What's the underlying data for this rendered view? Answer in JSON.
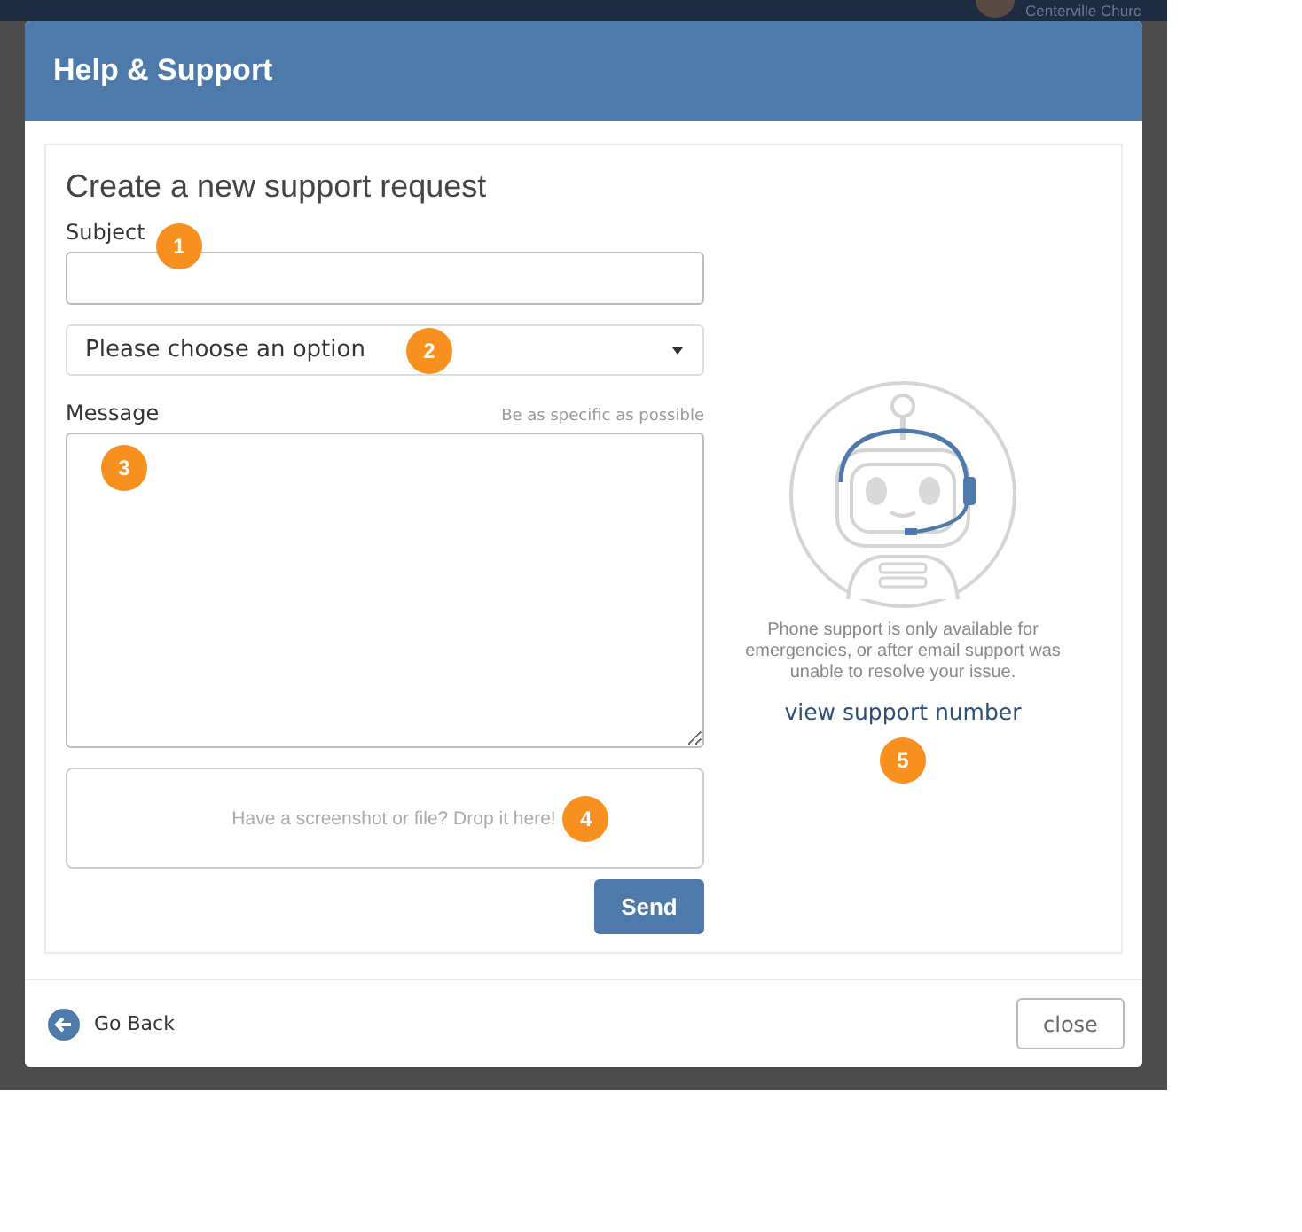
{
  "background_app": {
    "header_text": "Centerville Churc"
  },
  "dialog": {
    "title": "Help & Support"
  },
  "form": {
    "heading": "Create a new support request",
    "subject": {
      "label": "Subject",
      "badge": "1"
    },
    "category": {
      "value": "Please choose an option",
      "badge": "2"
    },
    "message": {
      "label": "Message",
      "hint": "Be as specific as possible",
      "badge": "3"
    },
    "dropzone": {
      "text": "Have a screenshot or file? Drop it here!",
      "badge": "4"
    },
    "send_button": "Send"
  },
  "phone_support": {
    "note": "Phone support is only available for emergencies, or after email support was unable to resolve your issue.",
    "link": "view support number",
    "badge": "5"
  },
  "footer": {
    "back": "Go Back",
    "close_button": "close"
  }
}
